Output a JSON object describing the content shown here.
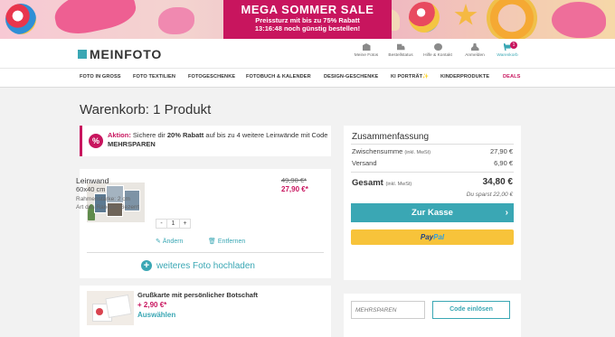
{
  "banner": {
    "title": "MEGA SOMMER SALE",
    "line1": "Preissturz mit bis zu 75% Rabatt",
    "line2": "13:16:48 noch günstig bestellen!",
    "color": "#c8155e"
  },
  "header": {
    "logo": "MEINFOTO",
    "utility": [
      {
        "label": "Meine Fotos",
        "icon": "store-icon"
      },
      {
        "label": "Bestellstatus",
        "icon": "truck-icon"
      },
      {
        "label": "Hilfe & Kontakt",
        "icon": "help-icon"
      },
      {
        "label": "Anmelden",
        "icon": "user-icon"
      },
      {
        "label": "Warenkorb",
        "icon": "cart-icon",
        "badge": "1"
      }
    ]
  },
  "nav": [
    "FOTO IN GROSS",
    "FOTO TEXTILIEN",
    "FOTOGESCHENKE",
    "FOTOBUCH & KALENDER",
    "DESIGN-GESCHENKE",
    "KI PORTRÄT✨",
    "KINDERPRODUKTE",
    "DEALS"
  ],
  "page": {
    "title": "Warenkorb: 1 Produkt"
  },
  "promo": {
    "icon": "%",
    "prefix": "Aktion:",
    "text1": " Sichere dir ",
    "highlight": "20% Rabatt",
    "text2": " auf bis zu 4 weitere Leinwände mit Code ",
    "code": "MEHRSPAREN"
  },
  "product": {
    "name": "Leinwand",
    "size": "60x40 cm",
    "frame": "Rahmenstärke: 2 cm",
    "edge": "Art des Randes: Gezerrt",
    "old_price": "49,90 €*",
    "new_price": "27,90 €*",
    "qty_minus": "-",
    "qty": "1",
    "qty_plus": "+",
    "edit": "Ändern",
    "remove": "Entfernen",
    "add_photo": "weiteres Foto hochladen"
  },
  "greeting": {
    "title": "Grußkarte mit persönlicher Botschaft",
    "price": "+ 2,90 €*",
    "select": "Auswählen"
  },
  "summary": {
    "title": "Zusammenfassung",
    "subtotal_label": "Zwischensumme",
    "incl": "(inkl. MwSt)",
    "subtotal": "27,90 €",
    "shipping_label": "Versand",
    "shipping": "6,90 €",
    "total_label": "Gesamt",
    "total_incl": "(inkl. MwSt)",
    "total": "34,80 €",
    "saved": "Du sparst 22,00 €",
    "checkout": "Zur Kasse",
    "paypal_a": "Pay",
    "paypal_b": "Pal"
  },
  "coupon": {
    "placeholder": "MEHRSPAREN",
    "button": "Code einlösen"
  },
  "colors": {
    "accent": "#3aa7b4",
    "brand": "#c8155e",
    "paypal": "#f7c33a"
  }
}
